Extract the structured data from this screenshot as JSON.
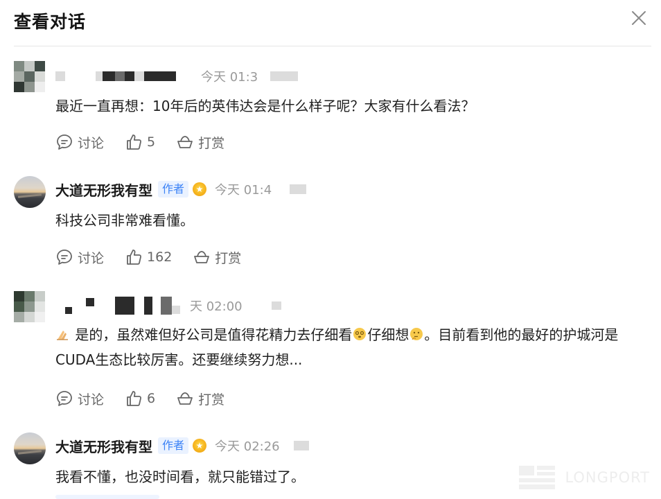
{
  "header": {
    "title": "查看对话"
  },
  "comments": [
    {
      "username": "",
      "time": "今天 01:3",
      "content": "最近一直再想：10年后的英伟达会是什么样子呢？大家有什么看法？",
      "actions": {
        "discuss_label": "讨论",
        "like_count": "5",
        "reward_label": "打赏"
      }
    },
    {
      "username": "大道无形我有型",
      "badge": "作者",
      "time": "今天 01:4",
      "content": "科技公司非常难看懂。",
      "actions": {
        "discuss_label": "讨论",
        "like_count": "162",
        "reward_label": "打赏"
      }
    },
    {
      "username": "",
      "time": "天 02:00",
      "content_part1": "是的，虽然难但好公司是值得花精力去仔细看",
      "content_part2": "仔细想",
      "content_part3": "。目前看到他的最好的护城河是CUDA生态比较厉害。还要继续努力想...",
      "actions": {
        "discuss_label": "讨论",
        "like_count": "6",
        "reward_label": "打赏"
      }
    },
    {
      "username": "大道无形我有型",
      "badge": "作者",
      "time": "今天 02:26",
      "content": "我看不懂，也没时间看，就只能错过了。"
    }
  ],
  "watermark": {
    "text": "LONGPORT"
  },
  "icons": {
    "close": "close-icon",
    "discuss": "chat-bubble-icon",
    "like": "thumbs-up-icon",
    "reward": "reward-bowl-icon",
    "medal": "medal-icon"
  },
  "colors": {
    "badge_bg": "#eaf2ff",
    "badge_text": "#3b82f6",
    "muted": "#9a9a9a",
    "medal": "#f5b21c"
  }
}
